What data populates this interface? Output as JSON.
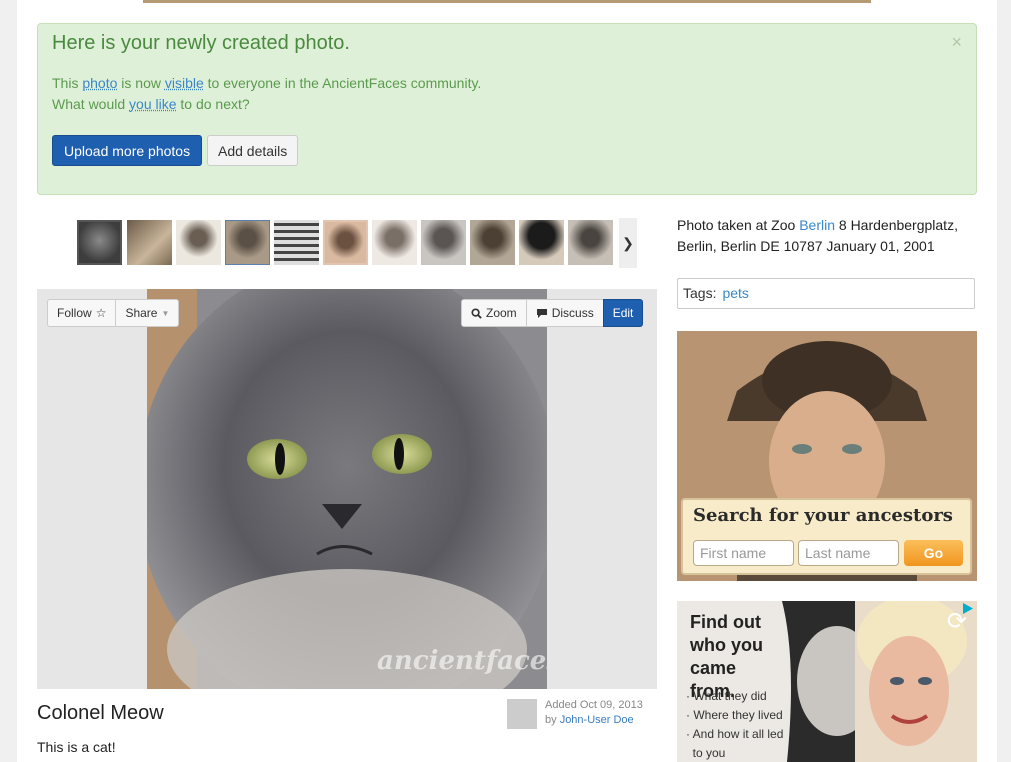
{
  "alert": {
    "title": "Here is your newly created photo.",
    "close": "×",
    "line1_pre": "This ",
    "line1_link1": "photo",
    "line1_mid": " is now ",
    "line1_link2": "visible",
    "line1_post": " to everyone in the AncientFaces community.",
    "line2_pre": "What would ",
    "line2_link": "you like",
    "line2_post": " to do next?",
    "upload_label": "Upload more photos",
    "details_label": "Add details"
  },
  "toolbar": {
    "follow_label": "Follow",
    "share_label": "Share",
    "zoom_label": "Zoom",
    "discuss_label": "Discuss",
    "edit_label": "Edit"
  },
  "photo": {
    "title": "Colonel Meow",
    "description": "This is a cat!",
    "watermark": "ancientfaces",
    "added": "Added Oct 09, 2013",
    "by": "by ",
    "author": "John-User Doe"
  },
  "location": {
    "pre": "Photo taken at Zoo ",
    "city_link": "Berlin",
    "post": " 8 Hardenbergplatz, Berlin, Berlin DE 10787 January 01, 2001"
  },
  "tags": {
    "label": "Tags:",
    "items": [
      "pets"
    ]
  },
  "ad_search": {
    "heading": "Search for your ancestors",
    "first_placeholder": "First name",
    "last_placeholder": "Last name",
    "go_label": "Go"
  },
  "ad_find": {
    "heading": "Find out who you came from.",
    "bullets": [
      "· What they did",
      "· Where they lived",
      "· And how it all led",
      "  to you"
    ]
  },
  "colors": {
    "accent": "#1f5fb0",
    "alert_bg": "#dff0d8",
    "link": "#3a87c8"
  }
}
